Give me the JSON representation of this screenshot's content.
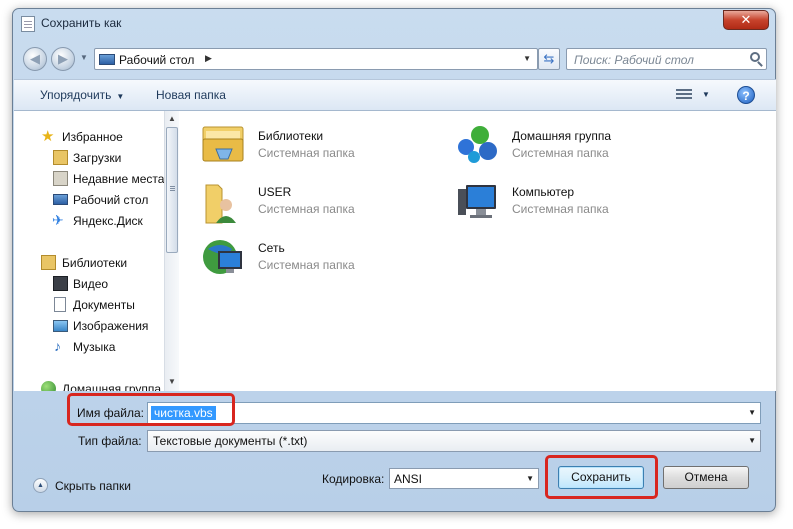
{
  "window": {
    "title": "Сохранить как",
    "close_label": "✕"
  },
  "navigation": {
    "back_glyph": "◀",
    "forward_glyph": "▶",
    "address": "Рабочий стол",
    "address_separator": "▶",
    "search_placeholder": "Поиск: Рабочий стол"
  },
  "toolbar": {
    "organize": "Упорядочить",
    "new_folder": "Новая папка",
    "help": "?"
  },
  "sidebar": {
    "favorites": {
      "label": "Избранное",
      "items": [
        "Загрузки",
        "Недавние места",
        "Рабочий стол",
        "Яндекс.Диск"
      ]
    },
    "libraries": {
      "label": "Библиотеки",
      "items": [
        "Видео",
        "Документы",
        "Изображения",
        "Музыка"
      ]
    },
    "homegroup": "Домашняя группа"
  },
  "files": [
    {
      "name": "Библиотеки",
      "desc": "Системная папка",
      "icon": "libraries-icon"
    },
    {
      "name": "Домашняя группа",
      "desc": "Системная папка",
      "icon": "homegroup-icon"
    },
    {
      "name": "USER",
      "desc": "Системная папка",
      "icon": "user-folder-icon"
    },
    {
      "name": "Компьютер",
      "desc": "Системная папка",
      "icon": "computer-icon"
    },
    {
      "name": "Сеть",
      "desc": "Системная папка",
      "icon": "network-icon"
    }
  ],
  "form": {
    "filename_label": "Имя файла:",
    "filename_value": "чистка.vbs",
    "filetype_label": "Тип файла:",
    "filetype_value": "Текстовые документы (*.txt)",
    "encoding_label": "Кодировка:",
    "encoding_value": "ANSI",
    "hide_folders": "Скрыть папки",
    "save": "Сохранить",
    "cancel": "Отмена"
  },
  "colors": {
    "highlight": "#d8261f",
    "selection": "#3399ff",
    "window_frame": "#c9dcef"
  }
}
